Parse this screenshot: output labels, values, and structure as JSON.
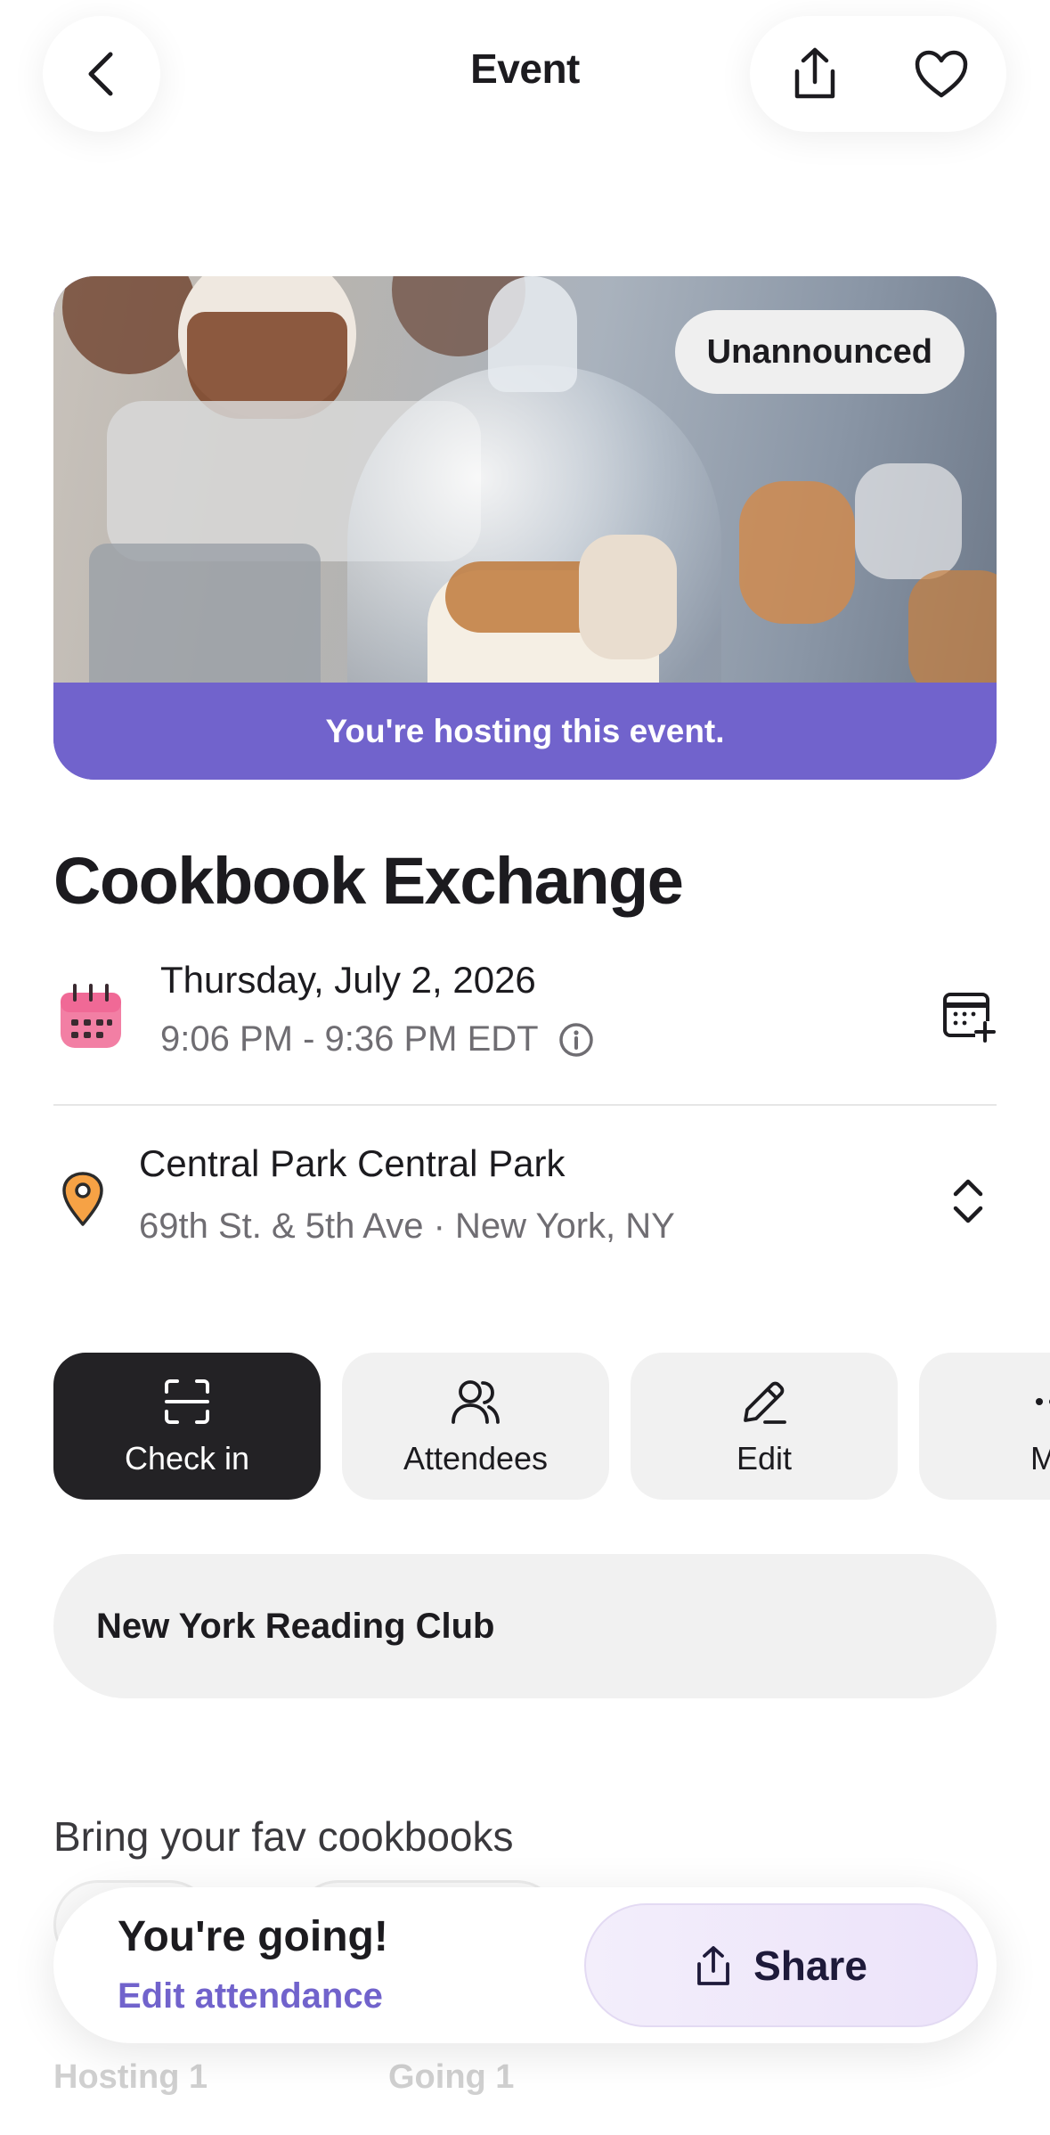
{
  "header": {
    "title": "Event",
    "back_icon": "chevron-left-icon",
    "share_icon": "share-icon",
    "favorite_icon": "heart-icon"
  },
  "hero": {
    "badge": "Unannounced",
    "hosting_text": "You're hosting this event.",
    "strip_color": "#7163cc"
  },
  "event": {
    "title": "Cookbook Exchange",
    "date": "Thursday, July 2, 2026",
    "time": "9:06 PM - 9:36 PM EDT",
    "location_name": "Central Park Central Park",
    "location_address": "69th St. & 5th Ave  · New York, NY"
  },
  "actions": [
    {
      "label": "Check in",
      "icon": "scan-icon"
    },
    {
      "label": "Attendees",
      "icon": "people-icon"
    },
    {
      "label": "Edit",
      "icon": "pencil-icon"
    },
    {
      "label": "Mo",
      "icon": "more-icon"
    }
  ],
  "club": {
    "name": "New York Reading Club"
  },
  "description": "Bring your fav cookbooks",
  "stats": {
    "hosting": "Hosting 1",
    "going": "Going 1"
  },
  "bottom_bar": {
    "status": "You're going!",
    "edit_link": "Edit attendance",
    "share_label": "Share"
  },
  "colors": {
    "accent": "#7163cc",
    "dark": "#232225",
    "chip": "#f1f1f1"
  }
}
